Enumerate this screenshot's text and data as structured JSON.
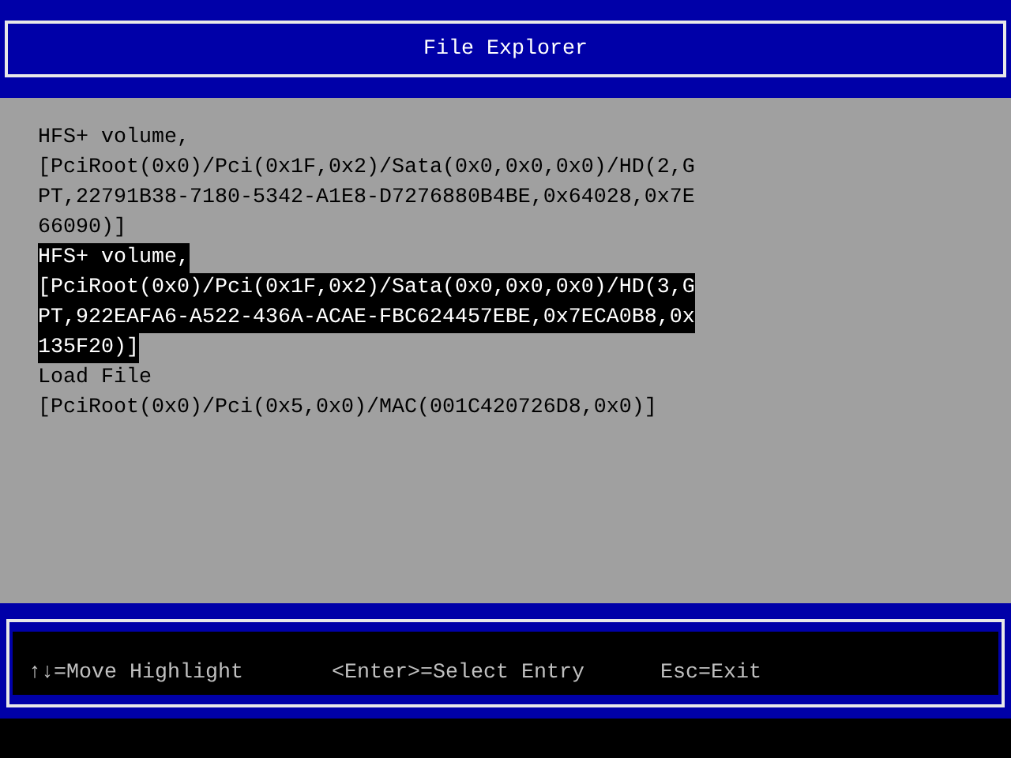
{
  "window": {
    "title": "File Explorer"
  },
  "entries": [
    {
      "name": "HFS+ volume,",
      "path_lines": [
        "[PciRoot(0x0)/Pci(0x1F,0x2)/Sata(0x0,0x0,0x0)/HD(2,G",
        "PT,22791B38-7180-5342-A1E8-D7276880B4BE,0x64028,0x7E",
        "66090)]"
      ],
      "selected": false
    },
    {
      "name": "HFS+ volume,",
      "path_lines": [
        "[PciRoot(0x0)/Pci(0x1F,0x2)/Sata(0x0,0x0,0x0)/HD(3,G",
        "PT,922EAFA6-A522-436A-ACAE-FBC624457EBE,0x7ECA0B8,0x",
        "135F20)]"
      ],
      "selected": true
    },
    {
      "name": "Load File",
      "path_lines": [
        "[PciRoot(0x0)/Pci(0x5,0x0)/MAC(001C420726D8,0x0)]"
      ],
      "selected": false
    }
  ],
  "help": [
    "↑↓=Move Highlight",
    "<Enter>=Select Entry",
    "Esc=Exit"
  ]
}
